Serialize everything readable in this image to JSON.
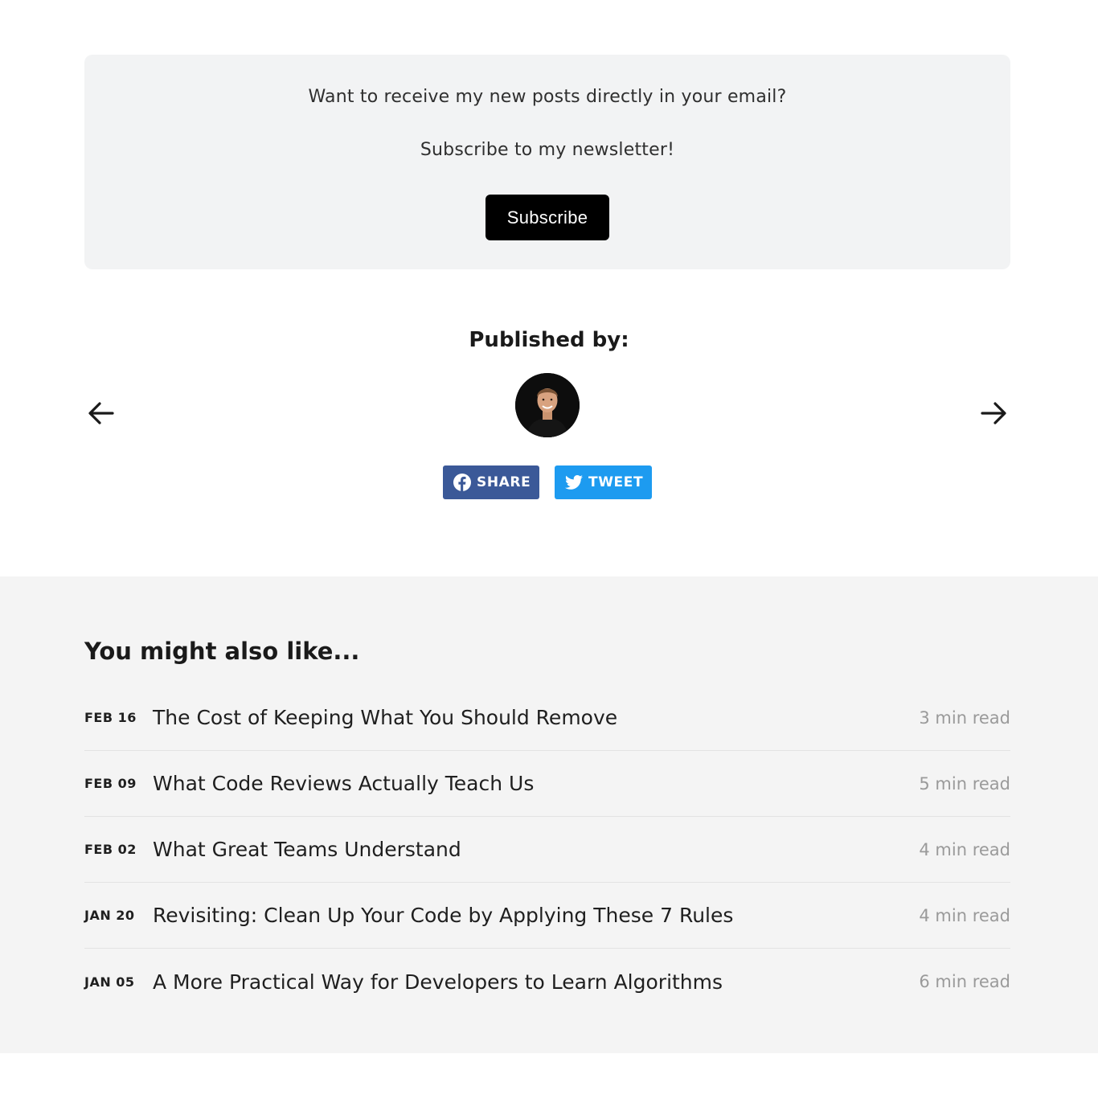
{
  "newsletter": {
    "prompt": "Want to receive my new posts directly in your email?",
    "cta_text": "Subscribe to my newsletter!",
    "button_label": "Subscribe"
  },
  "author": {
    "heading": "Published by:"
  },
  "navigation": {
    "prev_icon": "arrow-left-icon",
    "next_icon": "arrow-right-icon"
  },
  "share": {
    "facebook_label": "SHARE",
    "twitter_label": "TWEET",
    "facebook_color": "#3b5998",
    "twitter_color": "#1d9bf0"
  },
  "related": {
    "heading": "You might also like...",
    "posts": [
      {
        "date": "FEB 16",
        "title": "The Cost of Keeping What You Should Remove",
        "read_time": "3 min read"
      },
      {
        "date": "FEB 09",
        "title": "What Code Reviews Actually Teach Us",
        "read_time": "5 min read"
      },
      {
        "date": "FEB 02",
        "title": "What Great Teams Understand",
        "read_time": "4 min read"
      },
      {
        "date": "JAN 20",
        "title": "Revisiting: Clean Up Your Code by Applying These 7 Rules",
        "read_time": "4 min read"
      },
      {
        "date": "JAN 05",
        "title": "A More Practical Way for Developers to Learn Algorithms",
        "read_time": "6 min read"
      }
    ]
  }
}
